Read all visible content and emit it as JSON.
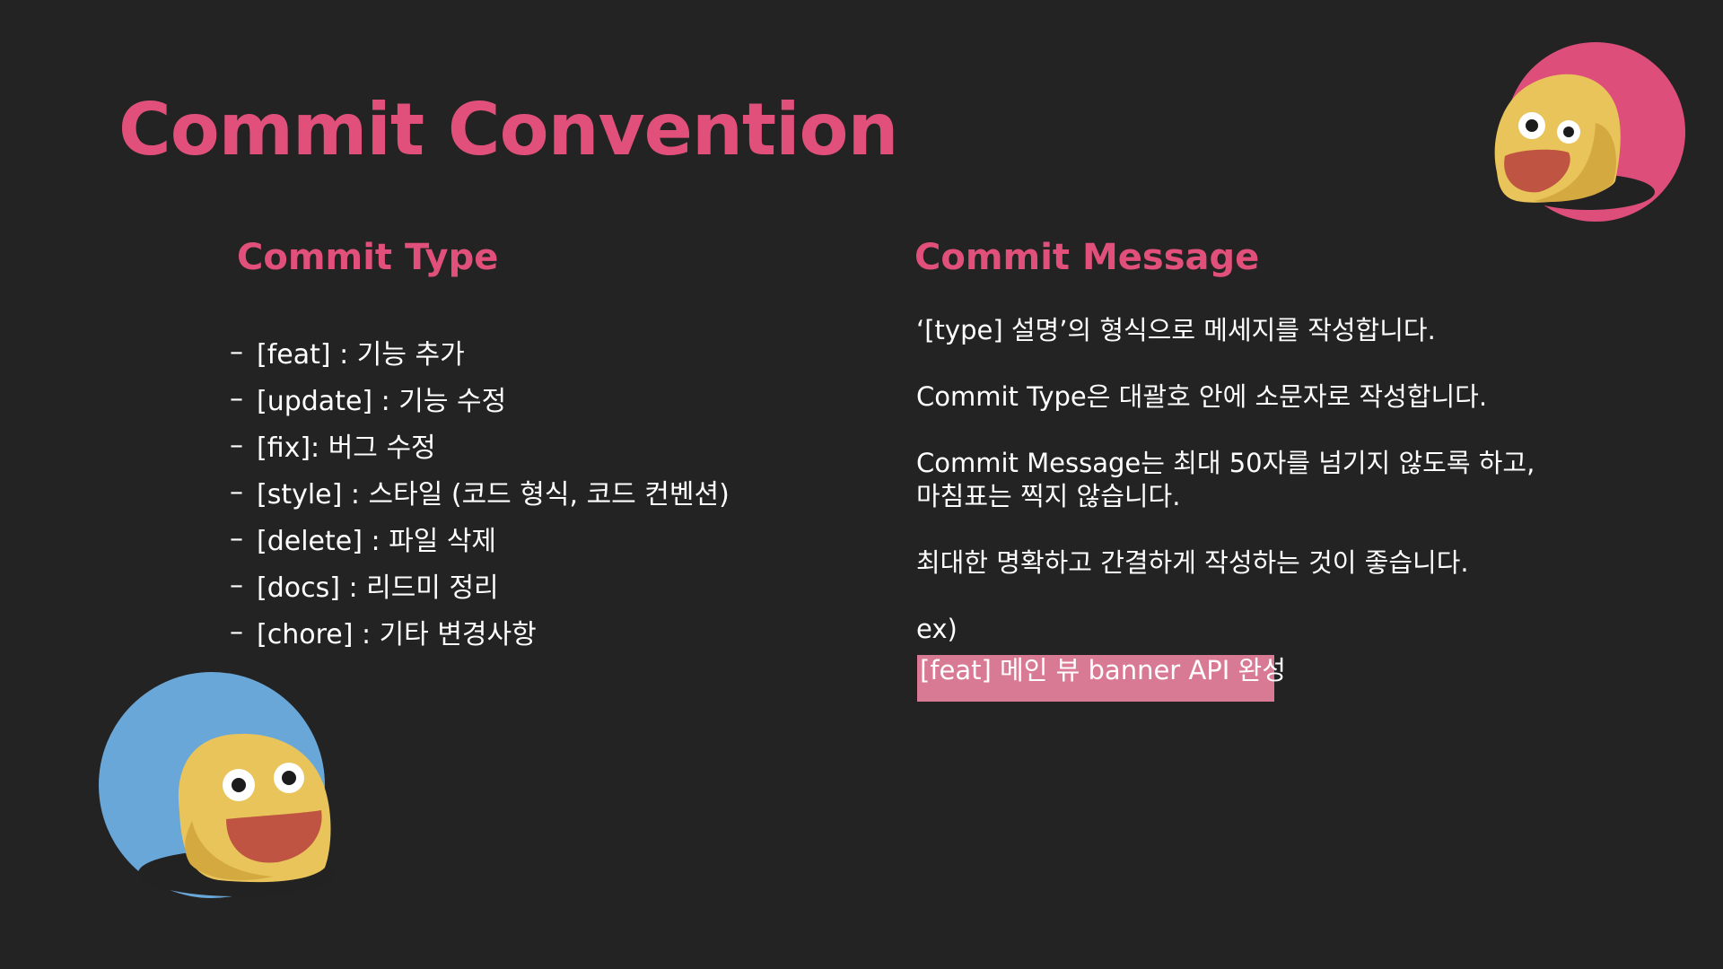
{
  "title": "Commit Convention",
  "commit_type": {
    "heading": "Commit Type",
    "dash": "–",
    "items": [
      "[feat] : 기능 추가",
      "[update] : 기능 수정",
      "[fix]:  버그 수정",
      "[style] : 스타일 (코드 형식, 코드 컨벤션)",
      "[delete] : 파일 삭제",
      "[docs] : 리드미 정리",
      "[chore] : 기타 변경사항"
    ]
  },
  "commit_message": {
    "heading": "Commit Message",
    "rules": [
      [
        "‘[type] 설명’의 형식으로 메세지를 작성합니다."
      ],
      [
        "Commit Type은 대괄호 안에 소문자로 작성합니다."
      ],
      [
        "Commit Message는 최대 50자를 넘기지 않도록 하고,",
        "마침표는 찍지 않습니다."
      ],
      [
        "최대한 명확하고 간결하게 작성하는 것이 좋습니다."
      ]
    ],
    "example_label": "ex)",
    "example": "[feat] 메인 뷰 banner API 완성"
  },
  "colors": {
    "background": "#232323",
    "accent": "#e0507a",
    "example_highlight": "#d97a94",
    "mascot_top_circle": "#dd4f7a",
    "mascot_bottom_circle": "#6aa7d9",
    "mascot_body": "#e8c45a"
  },
  "icons": {
    "mascot_top": "happy-blob-pink-icon",
    "mascot_bottom": "happy-blob-blue-icon"
  }
}
